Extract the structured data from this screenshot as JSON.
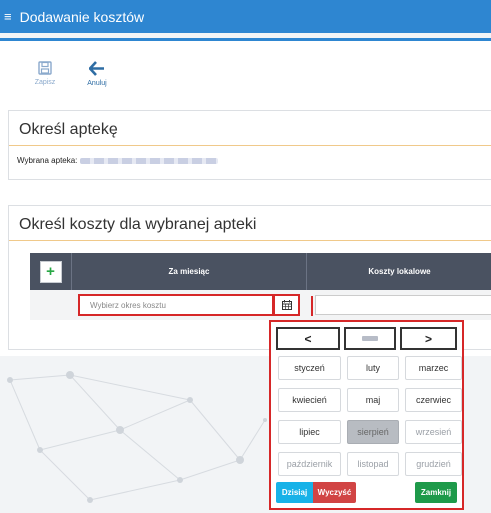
{
  "header": {
    "menu_icon": "hamburger-icon",
    "title": "Dodawanie kosztów"
  },
  "toolbar": {
    "save_label": "Zapisz",
    "cancel_label": "Anuluj"
  },
  "pharmacy_panel": {
    "title": "Określ aptekę",
    "selected_label": "Wybrana apteka:"
  },
  "costs_panel": {
    "title": "Określ koszty dla wybranej apteki",
    "add_symbol": "+",
    "columns": [
      "Za miesiąc",
      "Koszty lokalowe"
    ],
    "month_placeholder": "Wybierz okres kosztu"
  },
  "picker": {
    "prev": "<",
    "next": ">",
    "months": [
      "styczeń",
      "luty",
      "marzec",
      "kwiecień",
      "maj",
      "czerwiec",
      "lipiec",
      "sierpień",
      "wrzesień",
      "październik",
      "listopad",
      "grudzień"
    ],
    "today_label": "Dzisiaj",
    "clear_label": "Wyczyść",
    "close_label": "Zamknij"
  },
  "colors": {
    "topbar": "#2e86d1",
    "highlight": "#d62728",
    "today": "#17b2e8",
    "clear": "#d14444",
    "close": "#1e9a4a"
  }
}
